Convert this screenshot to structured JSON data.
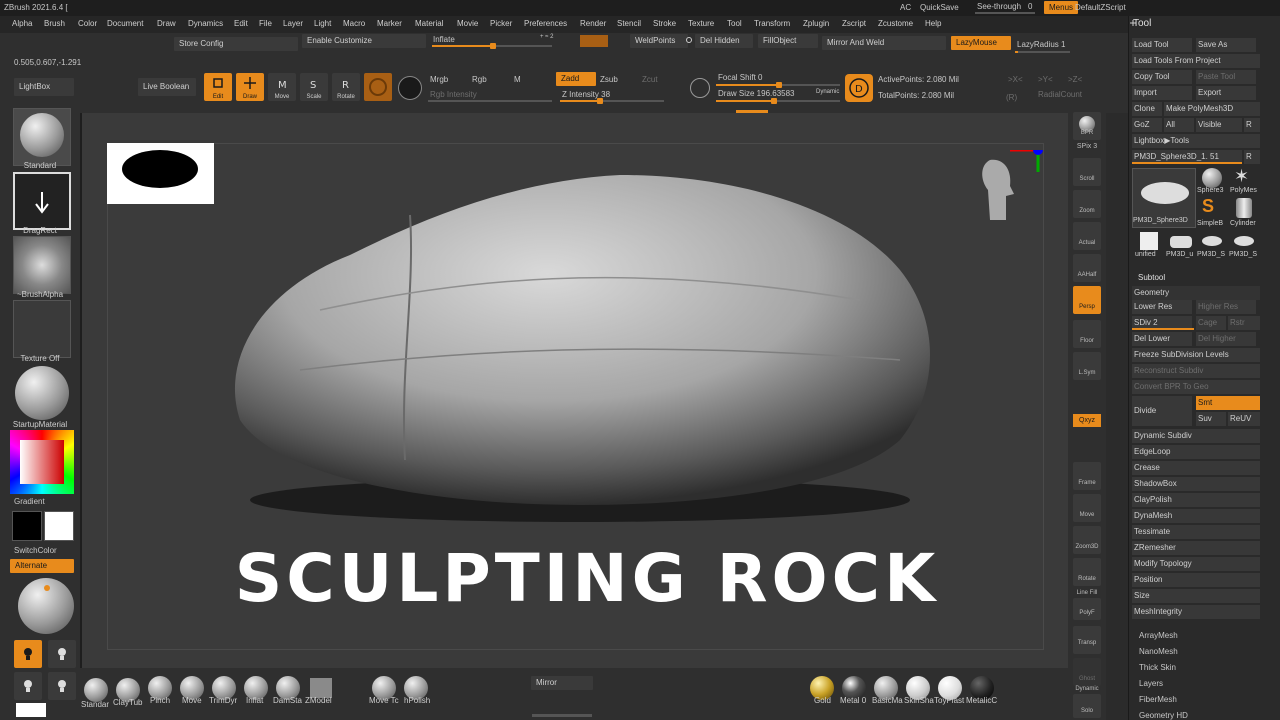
{
  "window": {
    "title": "ZBrush 2021.6.4 [",
    "ac": "AC",
    "quicksave": "QuickSave",
    "see_through_label": "See-through",
    "see_through_value": "0",
    "menus": "Menus",
    "default_zscript": "DefaultZScript"
  },
  "menu": [
    "Alpha",
    "Brush",
    "Color",
    "Document",
    "Draw",
    "Dynamics",
    "Edit",
    "File",
    "Layer",
    "Light",
    "Macro",
    "Marker",
    "Material",
    "Movie",
    "Picker",
    "Preferences",
    "Render",
    "Stencil",
    "Stroke",
    "Texture",
    "Tool",
    "Transform",
    "Zplugin",
    "Zscript",
    "Zcustome",
    "Help"
  ],
  "top": {
    "store_config": "Store Config",
    "enable_customize": "Enable Customize",
    "inflate": "Inflate",
    "inflate_pct": 0.48,
    "weldpoints": "WeldPoints",
    "del_hidden": "Del Hidden",
    "fillobject": "FillObject",
    "mirror_and_weld": "Mirror And Weld",
    "lazymouse": "LazyMouse",
    "lazyradius": "LazyRadius 1",
    "coords": "0.505,0.607,-1.291",
    "lightbox": "LightBox",
    "live_boolean": "Live Boolean",
    "edit": "Edit",
    "draw": "Draw",
    "move": "Move",
    "scale": "Scale",
    "rotate": "Rotate",
    "mrgb": "Mrgb",
    "rgb": "Rgb",
    "m": "M",
    "rgb_intensity": "Rgb Intensity",
    "zadd": "Zadd",
    "zsub": "Zsub",
    "zcut": "Zcut",
    "z_intensity": "Z Intensity 38",
    "z_intensity_pct": 0.38,
    "focal_shift": "Focal Shift 0",
    "draw_size": "Draw Size 196.63583",
    "dynamic": "Dynamic",
    "active_points": "ActivePoints: 2.080 Mil",
    "total_points": "TotalPoints: 2.080 Mil",
    "xyz_x": ">X<",
    "xyz_y": ">Y<",
    "xyz_z": ">Z<",
    "r": "(R)",
    "radial_count": "RadialCount"
  },
  "left": {
    "standard": "Standard",
    "dragrect": "DragRect",
    "brushalpha": "~BrushAlpha",
    "texture_off": "Texture Off",
    "startup_material": "StartupMaterial",
    "gradient": "Gradient",
    "switchcolor": "SwitchColor",
    "alternate": "Alternate"
  },
  "canvas": {
    "headline": "SCULPTING ROCK"
  },
  "right_shelf": [
    "BPR",
    "SPix 3",
    "Scroll",
    "Zoom",
    "Actual",
    "AAHalf",
    "Persp",
    "Floor",
    "L.Sym",
    "Qxyz",
    "Frame",
    "Move",
    "Zoom3D",
    "Rotate",
    "Line Fill",
    "PolyF",
    "Transp",
    "Ghost",
    "Dynamic",
    "Solo"
  ],
  "bottom": {
    "brushes": [
      "Standar",
      "ClayTub",
      "Pinch",
      "Move",
      "TrimDyr",
      "Inflat",
      "DamSta",
      "ZModel",
      "Move Tc",
      "hPolish"
    ],
    "mirror": "Mirror",
    "materials": [
      "Gold",
      "Metal 0",
      "BasicMa",
      "SkinSha",
      "ToyPlast",
      "MetalicC"
    ]
  },
  "tool": {
    "title": "Tool",
    "load_tool": "Load Tool",
    "save_as": "Save As",
    "load_from_project": "Load Tools From Project",
    "copy_tool": "Copy Tool",
    "paste_tool": "Paste Tool",
    "import": "Import",
    "export": "Export",
    "clone": "Clone",
    "make_polymesh": "Make PolyMesh3D",
    "goz": "GoZ",
    "all": "All",
    "visible": "Visible",
    "r": "R",
    "lightbox_tools": "Lightbox▶Tools",
    "current": "PM3D_Sphere3D_1. 51",
    "thumbs": [
      "PM3D_Sphere3D",
      "Sphere3",
      "PolyMes",
      "SimpleB",
      "Cylinder",
      "unified",
      "PM3D_u",
      "PM3D_S",
      "PM3D_S"
    ],
    "subtool": "Subtool",
    "geometry": "Geometry",
    "lower_res": "Lower Res",
    "higher_res": "Higher Res",
    "sdiv": "SDiv 2",
    "cage": "Cage",
    "rstr": "Rstr",
    "del_lower": "Del Lower",
    "del_higher": "Del Higher",
    "freeze_subdiv": "Freeze SubDivision Levels",
    "reconstruct_subdiv": "Reconstruct Subdiv",
    "convert_bpr": "Convert BPR To Geo",
    "divide": "Divide",
    "smt": "Smt",
    "suv": "Suv",
    "reuv": "ReUV",
    "items": [
      "Dynamic Subdiv",
      "EdgeLoop",
      "Crease",
      "ShadowBox",
      "ClayPolish",
      "DynaMesh",
      "Tessimate",
      "ZRemesher",
      "Modify Topology",
      "Position",
      "Size",
      "MeshIntegrity"
    ],
    "lower_items": [
      "ArrayMesh",
      "NanoMesh",
      "Thick Skin",
      "Layers",
      "FiberMesh",
      "Geometry HD"
    ]
  }
}
